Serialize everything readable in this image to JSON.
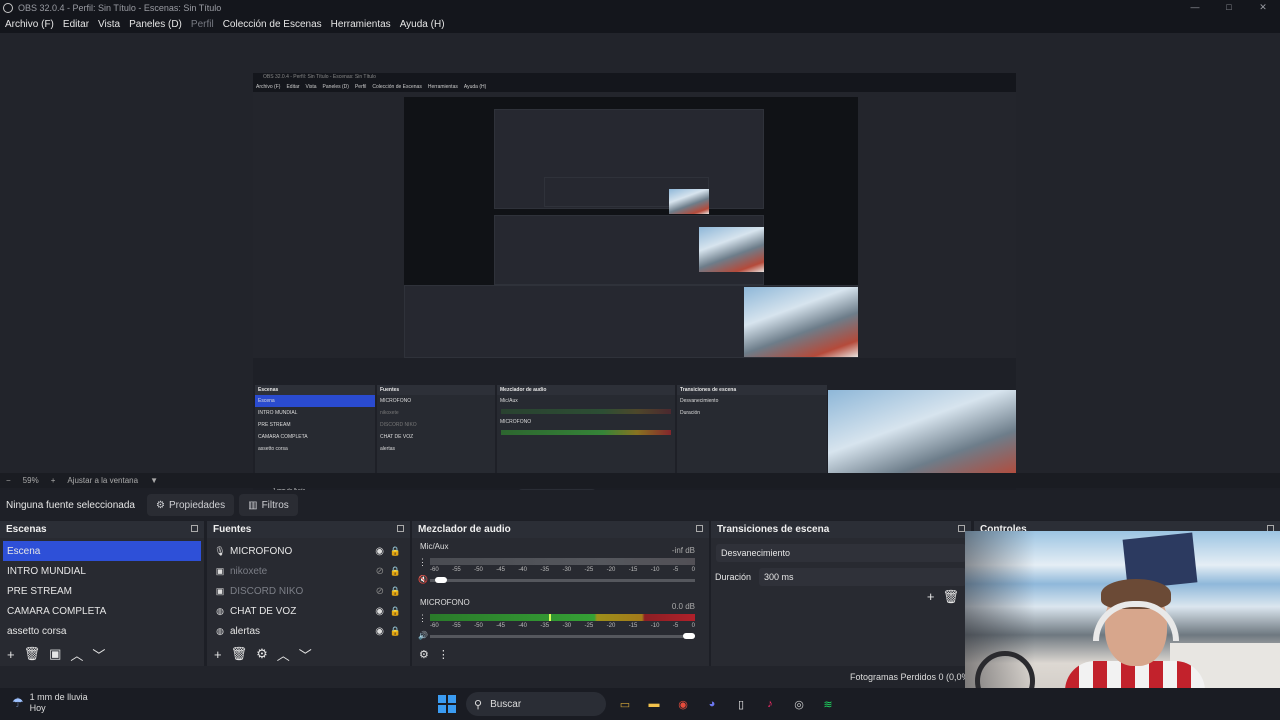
{
  "window": {
    "title": "OBS 32.0.4 - Perfil: Sin Título - Escenas: Sin Título",
    "minimize": "—",
    "maximize": "□",
    "close": "✕"
  },
  "menu": [
    {
      "label": "Archivo (F)",
      "enabled": true
    },
    {
      "label": "Editar",
      "enabled": true
    },
    {
      "label": "Vista",
      "enabled": true
    },
    {
      "label": "Paneles (D)",
      "enabled": true
    },
    {
      "label": "Perfil",
      "enabled": false
    },
    {
      "label": "Colección de Escenas",
      "enabled": true
    },
    {
      "label": "Herramientas",
      "enabled": true
    },
    {
      "label": "Ayuda (H)",
      "enabled": true
    }
  ],
  "zoom": {
    "minus": "−",
    "value": "59%",
    "plus": "+",
    "fit_label": "Ajustar a la ventana",
    "dropdown": "▼"
  },
  "source_toolbar": {
    "no_source": "Ninguna fuente seleccionada",
    "properties": "Propiedades",
    "filters": "Filtros"
  },
  "scenes": {
    "title": "Escenas",
    "items": [
      {
        "label": "Escena",
        "selected": true
      },
      {
        "label": "INTRO MUNDIAL",
        "selected": false
      },
      {
        "label": "PRE STREAM",
        "selected": false
      },
      {
        "label": "CAMARA COMPLETA",
        "selected": false
      },
      {
        "label": "assetto corsa",
        "selected": false
      }
    ],
    "footer": [
      "+",
      "🗑",
      "▣",
      "︿",
      "﹀"
    ]
  },
  "sources": {
    "title": "Fuentes",
    "items": [
      {
        "label": "MICROFONO",
        "icon": "microphone-icon",
        "glyph": "🎙",
        "visible": true
      },
      {
        "label": "nikoxete",
        "icon": "image-icon",
        "glyph": "▣",
        "visible": false
      },
      {
        "label": "DISCORD NIKO",
        "icon": "image-icon",
        "glyph": "▣",
        "visible": false
      },
      {
        "label": "CHAT DE VOZ",
        "icon": "globe-icon",
        "glyph": "◍",
        "visible": true
      },
      {
        "label": "alertas",
        "icon": "globe-icon",
        "glyph": "◍",
        "visible": true
      }
    ],
    "footer": [
      "+",
      "🗑",
      "⚙",
      "︿",
      "﹀"
    ]
  },
  "mixer": {
    "title": "Mezclador de audio",
    "ticks": [
      "-60",
      "-55",
      "-50",
      "-45",
      "-40",
      "-35",
      "-30",
      "-25",
      "-20",
      "-15",
      "-10",
      "-5",
      "0"
    ],
    "channels": [
      {
        "name": "Mic/Aux",
        "db": "-inf dB",
        "level": 0.0,
        "volume": 0.02
      },
      {
        "name": "MICROFONO",
        "db": "0.0 dB",
        "level": 0.45,
        "volume": 1.0
      }
    ],
    "footer": [
      "⚙",
      "⋮"
    ]
  },
  "transitions": {
    "title": "Transiciones de escena",
    "selected": "Desvanecimiento",
    "duration_label": "Duración",
    "duration_value": "300 ms",
    "add": "+",
    "remove": "🗑"
  },
  "controls": {
    "title": "Controles"
  },
  "status": {
    "dropped_frames": "Fotogramas Perdidos 0 (0,0%)"
  },
  "taskbar": {
    "weather_line1": "1 mm de lluvia",
    "weather_line2": "Hoy",
    "search_placeholder": "Buscar",
    "apps": [
      {
        "name": "explorer-icon",
        "glyph": "▭",
        "color": "#d7a93a"
      },
      {
        "name": "folder-icon",
        "glyph": "▬",
        "color": "#f2c24c"
      },
      {
        "name": "chrome-icon",
        "glyph": "◉",
        "color": "#e74c3c"
      },
      {
        "name": "discord-icon",
        "glyph": "◕",
        "color": "#6c78f0"
      },
      {
        "name": "file-icon",
        "glyph": "▯",
        "color": "#e6e6e6"
      },
      {
        "name": "tiktok-icon",
        "glyph": "♪",
        "color": "#ff2c6a"
      },
      {
        "name": "obs-icon",
        "glyph": "◎",
        "color": "#cfcfcf"
      },
      {
        "name": "spotify-icon",
        "glyph": "≋",
        "color": "#1ed760"
      }
    ]
  }
}
